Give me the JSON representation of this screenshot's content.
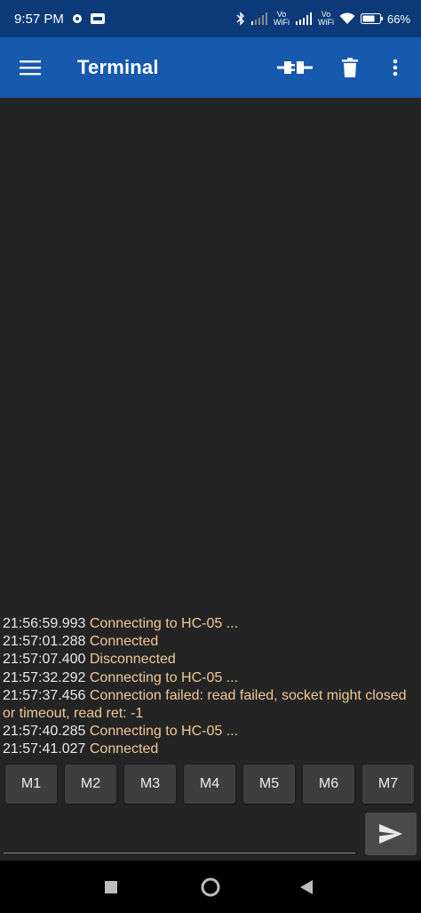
{
  "status_bar": {
    "time": "9:57 PM",
    "volte1": "Vo\nWiFi",
    "volte2": "Vo\nWiFi",
    "battery": "66",
    "battery_unit": "%"
  },
  "app_bar": {
    "title": "Terminal"
  },
  "log": [
    {
      "ts": "21:56:59.993",
      "msg": "Connecting to HC-05 ..."
    },
    {
      "ts": "21:57:01.288",
      "msg": "Connected"
    },
    {
      "ts": "21:57:07.400",
      "msg": "Disconnected"
    },
    {
      "ts": "21:57:32.292",
      "msg": "Connecting to HC-05 ..."
    },
    {
      "ts": "21:57:37.456",
      "msg": "Connection failed: read failed, socket might closed or timeout, read ret: -1"
    },
    {
      "ts": "21:57:40.285",
      "msg": "Connecting to HC-05 ..."
    },
    {
      "ts": "21:57:41.027",
      "msg": "Connected"
    }
  ],
  "macros": [
    "M1",
    "M2",
    "M3",
    "M4",
    "M5",
    "M6",
    "M7"
  ],
  "input": {
    "value": "",
    "placeholder": ""
  },
  "colors": {
    "status_bar": "#0c3a78",
    "app_bar": "#1659ad",
    "background": "#242424",
    "log_text": "#f0c896"
  },
  "icons": {
    "menu": "hamburger-icon",
    "connect": "plug-connect-icon",
    "delete": "trash-icon",
    "more": "more-vert-icon",
    "send": "send-icon"
  }
}
